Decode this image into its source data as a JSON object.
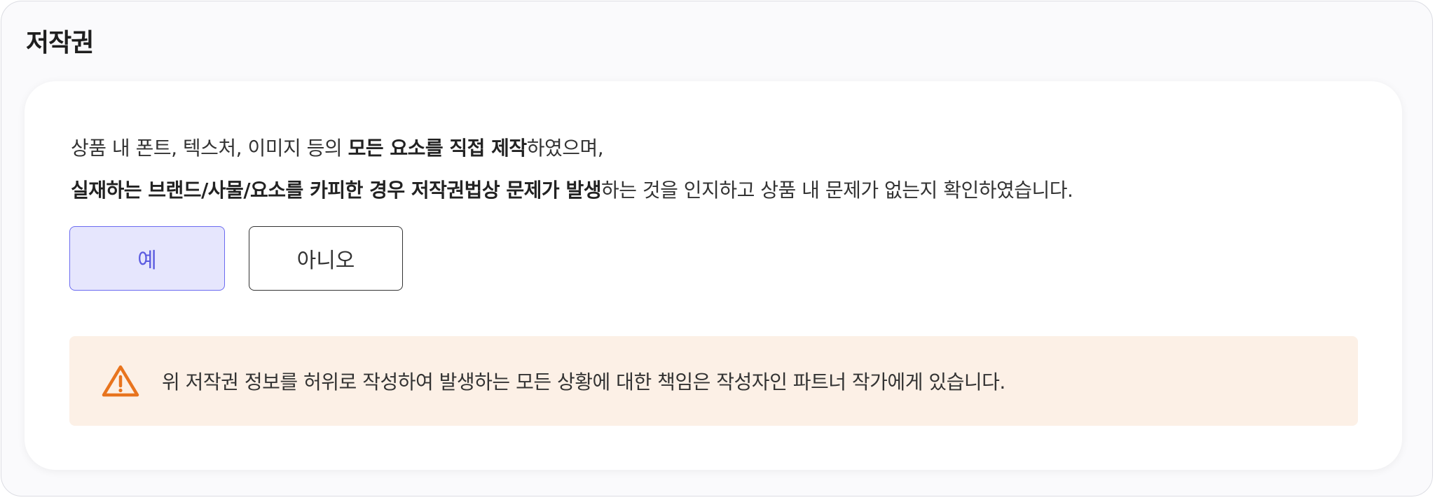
{
  "section": {
    "title": "저작권"
  },
  "description": {
    "line1_normal_1": "상품 내 폰트, 텍스처, 이미지 등의 ",
    "line1_bold": "모든 요소를 직접 제작",
    "line1_normal_2": "하였으며,",
    "line2_bold": "실재하는 브랜드/사물/요소를 카피한 경우 저작권법상 문제가 발생",
    "line2_normal": "하는 것을 인지하고 상품 내 문제가 없는지 확인하였습니다."
  },
  "options": {
    "yes_label": "예",
    "no_label": "아니오",
    "selected": "예"
  },
  "notice": {
    "icon": "warning-triangle-icon",
    "text": "위 저작권 정보를 허위로 작성하여 발생하는 모든 상황에 대한 책임은 작성자인 파트너 작가에게 있습니다."
  },
  "colors": {
    "accent": "#6b6bf0",
    "selected_bg": "#e6e6fd",
    "notice_bg": "#fcf0e6",
    "warning": "#e8741e"
  }
}
